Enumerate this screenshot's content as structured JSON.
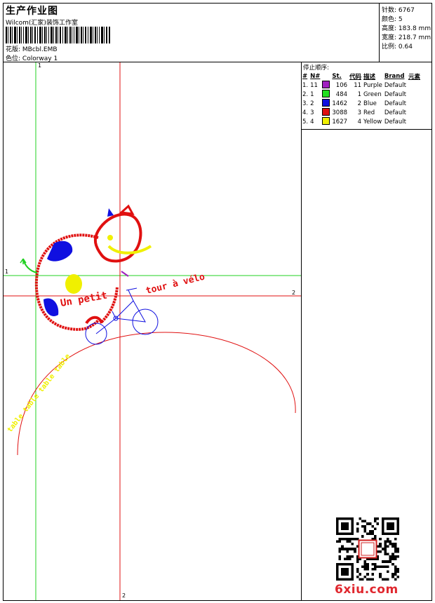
{
  "header": {
    "title": "生产作业图",
    "studio": "Wilcom(汇家)装饰工作室",
    "design": {
      "label": "花版:",
      "value": "MBcbl.EMB"
    },
    "colorway": {
      "label": "色位:",
      "value": "Colorway 1"
    }
  },
  "stats": [
    {
      "label": "针数:",
      "value": "6767"
    },
    {
      "label": "颜色:",
      "value": "5"
    },
    {
      "label": "高度:",
      "value": "183.8 mm"
    },
    {
      "label": "宽度:",
      "value": "218.7 mm"
    },
    {
      "label": "比例:",
      "value": "0.64"
    }
  ],
  "legend": {
    "title": "停止顺序:",
    "columns": [
      "#",
      "N#",
      "St.",
      "代码",
      "描述",
      "Brand",
      "元素"
    ],
    "rows": [
      {
        "idx": "1.",
        "n": "11",
        "color": "#a020c0",
        "st": "106",
        "code": "11",
        "desc": "Purple",
        "brand": "Default"
      },
      {
        "idx": "2.",
        "n": "1",
        "color": "#20e020",
        "st": "484",
        "code": "1",
        "desc": "Green",
        "brand": "Default"
      },
      {
        "idx": "3.",
        "n": "2",
        "color": "#1010e0",
        "st": "1462",
        "code": "2",
        "desc": "Blue",
        "brand": "Default"
      },
      {
        "idx": "4.",
        "n": "3",
        "color": "#e01010",
        "st": "3088",
        "code": "3",
        "desc": "Red",
        "brand": "Default"
      },
      {
        "idx": "5.",
        "n": "4",
        "color": "#f0f000",
        "st": "1627",
        "code": "4",
        "desc": "Yellow",
        "brand": "Default"
      }
    ]
  },
  "guides": {
    "green_v": "1",
    "green_h": "1",
    "red_h": "2",
    "red_v": "2"
  },
  "artwork": {
    "text_red_1": "Un petit",
    "text_red_2": "tour à vélo",
    "text_yellow": "table table table table",
    "colors": {
      "red": "#e01010",
      "blue": "#1010e0",
      "yellow": "#f0f000",
      "green": "#20e020",
      "purple": "#a020c0"
    }
  },
  "watermark": "6xiu.com"
}
